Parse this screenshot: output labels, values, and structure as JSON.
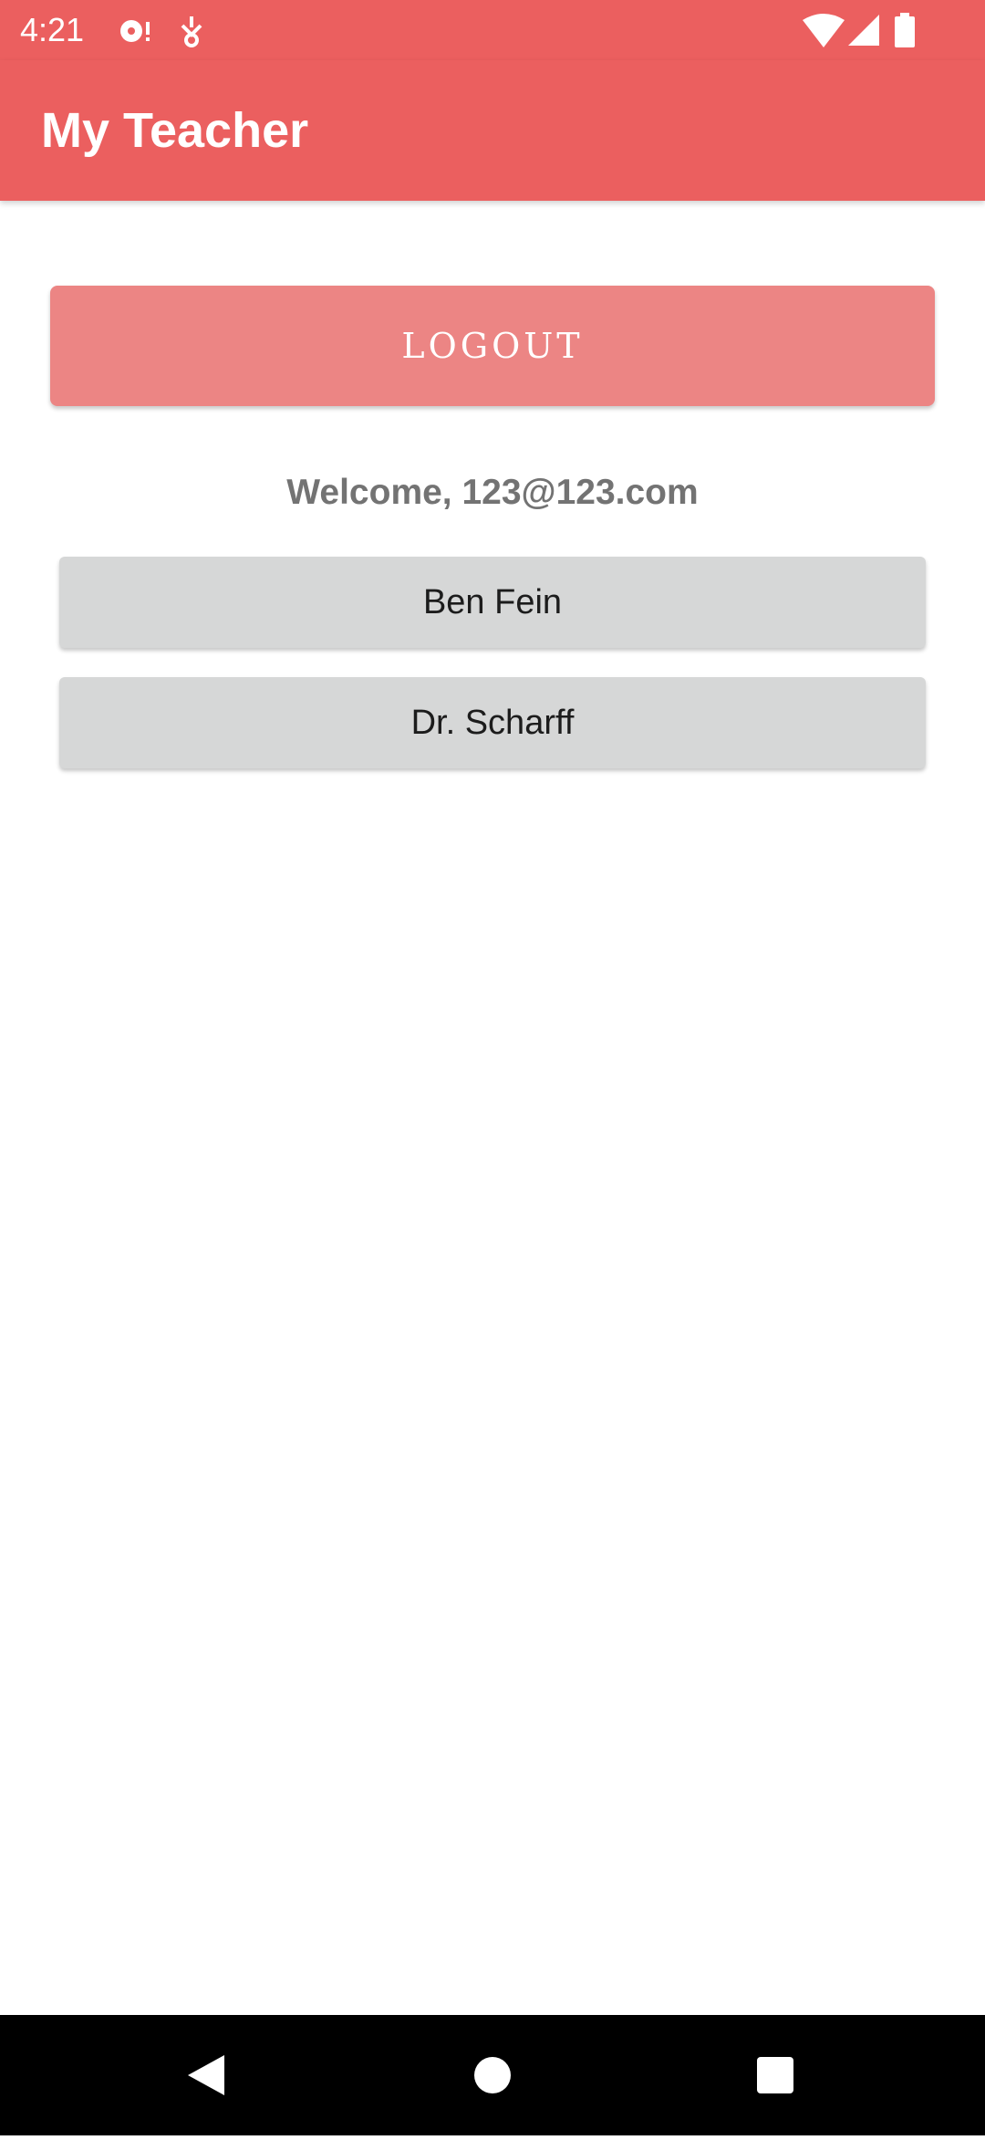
{
  "status_bar": {
    "time": "4:21",
    "left_icons": [
      "podcast-notification-icon",
      "download-notification-icon"
    ],
    "right_icons": [
      "wifi-icon",
      "cellular-signal-icon",
      "battery-icon"
    ]
  },
  "app_bar": {
    "title": "My Teacher"
  },
  "logout": {
    "label": "LOGOUT"
  },
  "welcome": {
    "text": "Welcome, 123@123.com"
  },
  "teachers": [
    {
      "name": "Ben Fein"
    },
    {
      "name": "Dr. Scharff"
    }
  ],
  "nav_bar": {
    "buttons": [
      "back-icon",
      "home-icon",
      "recents-icon"
    ]
  },
  "colors": {
    "primary": "#EB5F5F",
    "logout_button": "#EC8584",
    "list_button": "#D6D7D7",
    "welcome_text": "#737373"
  }
}
